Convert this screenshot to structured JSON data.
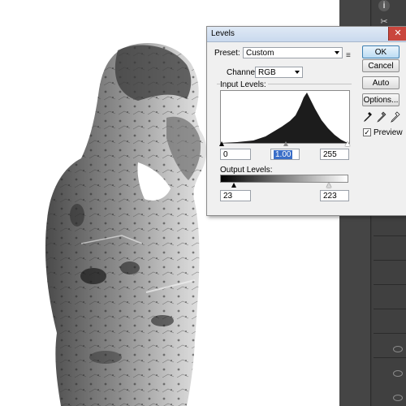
{
  "dialog": {
    "title": "Levels",
    "close_glyph": "✕",
    "preset_label": "Preset:",
    "preset_value": "Custom",
    "preset_menu_icon": "≡",
    "channel_label": "Channel:",
    "channel_value": "RGB",
    "input_levels_label": "Input Levels:",
    "input_values": {
      "black": "0",
      "gamma": "1.00",
      "white": "255"
    },
    "output_levels_label": "Output Levels:",
    "output_values": {
      "black": "23",
      "white": "223"
    },
    "buttons": {
      "ok": "OK",
      "cancel": "Cancel",
      "auto": "Auto",
      "options": "Options..."
    },
    "preview_label": "Preview",
    "preview_checked": "✓"
  },
  "right_panel": {
    "info_icon": "i",
    "tool_icon": "✂"
  },
  "colors": {
    "accent_selected": "#3a6ec8",
    "ok_border": "#3c7fb1",
    "close_red": "#c9463d",
    "panel_dark": "#3a3a3a"
  }
}
